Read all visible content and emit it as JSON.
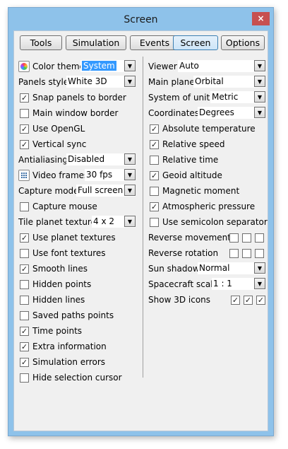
{
  "window": {
    "title": "Screen",
    "close_glyph": "×"
  },
  "tabs": [
    {
      "label": "Tools"
    },
    {
      "label": "Simulation"
    },
    {
      "label": "Events"
    },
    {
      "label": "Screen",
      "active": true
    },
    {
      "label": "Options"
    }
  ],
  "left": {
    "color_theme": {
      "label": "Color theme",
      "value": "System",
      "icon": "color-wheel-icon"
    },
    "panels_style": {
      "label": "Panels style",
      "value": "White 3D"
    },
    "snap_panels": {
      "label": "Snap panels to border",
      "checked": true
    },
    "main_window_border": {
      "label": "Main window border",
      "checked": false
    },
    "use_opengl": {
      "label": "Use OpenGL",
      "checked": true
    },
    "vertical_sync": {
      "label": "Vertical sync",
      "checked": true
    },
    "antialiasing": {
      "label": "Antialiasing",
      "value": "Disabled"
    },
    "video_frames": {
      "label": "Video frames",
      "value": "30 fps",
      "icon": "grid-icon"
    },
    "capture_mode": {
      "label": "Capture mode",
      "value": "Full screen"
    },
    "capture_mouse": {
      "label": "Capture mouse",
      "checked": false
    },
    "tile_planet_textures": {
      "label": "Tile planet textures",
      "value": "4 x 2"
    },
    "checks": [
      {
        "label": "Use planet textures",
        "checked": true
      },
      {
        "label": "Use font textures",
        "checked": false
      },
      {
        "label": "Smooth lines",
        "checked": true
      },
      {
        "label": "Hidden points",
        "checked": false
      },
      {
        "label": "Hidden lines",
        "checked": false
      },
      {
        "label": "Saved paths points",
        "checked": false
      },
      {
        "label": "Time points",
        "checked": true
      },
      {
        "label": "Extra information",
        "checked": true
      },
      {
        "label": "Simulation errors",
        "checked": true
      },
      {
        "label": "Hide selection cursor",
        "checked": false
      }
    ]
  },
  "right": {
    "viewer": {
      "label": "Viewer",
      "value": "Auto"
    },
    "main_plane": {
      "label": "Main plane",
      "value": "Orbital"
    },
    "system_of_units": {
      "label": "System of units",
      "value": "Metric"
    },
    "coordinates": {
      "label": "Coordinates",
      "value": "Degrees"
    },
    "checks": [
      {
        "label": "Absolute temperature",
        "checked": true
      },
      {
        "label": "Relative speed",
        "checked": true
      },
      {
        "label": "Relative time",
        "checked": false
      },
      {
        "label": "Geoid altitude",
        "checked": true
      },
      {
        "label": "Magnetic moment",
        "checked": false
      },
      {
        "label": "Atmospheric pressure",
        "checked": true
      },
      {
        "label": "Use semicolon separator",
        "checked": false
      }
    ],
    "reverse_movement": {
      "label": "Reverse movement",
      "checks": [
        false,
        false,
        false
      ]
    },
    "reverse_rotation": {
      "label": "Reverse rotation",
      "checks": [
        false,
        false,
        false
      ]
    },
    "sun_shadow": {
      "label": "Sun shadow",
      "value": "Normal"
    },
    "spacecraft_scale": {
      "label": "Spacecraft scale",
      "value": "1 : 1"
    },
    "show_3d_icons": {
      "label": "Show 3D icons",
      "checks": [
        true,
        true,
        true
      ]
    }
  },
  "glyphs": {
    "check": "✓",
    "arrow": "▼"
  }
}
